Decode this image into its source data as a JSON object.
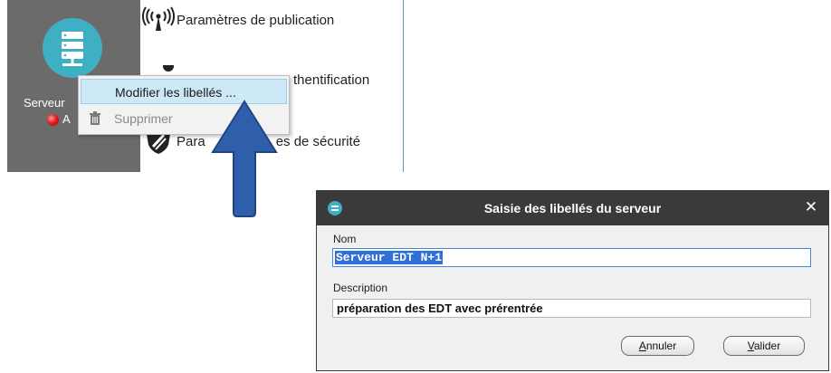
{
  "server_tile": {
    "label": "Serveur",
    "status_text": "A",
    "icon": "server-stack-icon",
    "icon_color": "#3fb0c4"
  },
  "side_menu": {
    "items": [
      {
        "label": "Paramètres de publication",
        "icon": "broadcast-icon"
      },
      {
        "label": "thentification",
        "icon": "wrench-icon"
      },
      {
        "label": "Paramètres de sécurité",
        "label_visible_left": "Para",
        "label_visible_right": "es de sécurité",
        "icon": "shield-icon"
      }
    ]
  },
  "context_menu": {
    "items": [
      {
        "label": "Modifier les libellés ...",
        "highlighted": true,
        "enabled": true
      },
      {
        "label": "Supprimer",
        "icon": "trash-icon",
        "highlighted": false,
        "enabled": false
      }
    ],
    "highlight_color": "#cde8f7"
  },
  "arrow": {
    "color": "#2f5faa",
    "icon": "arrow-down-right-icon"
  },
  "dialog": {
    "title": "Saisie des libellés du serveur",
    "title_bar_color": "#3a3a3a",
    "close_glyph": "✕",
    "fields": {
      "nom_label": "Nom",
      "nom_value": "Serveur EDT N+1",
      "description_label": "Description",
      "description_value": "préparation des EDT avec prérentrée"
    },
    "buttons": {
      "cancel_first": "A",
      "cancel_rest": "nnuler",
      "ok_first": "V",
      "ok_rest": "alider"
    }
  }
}
